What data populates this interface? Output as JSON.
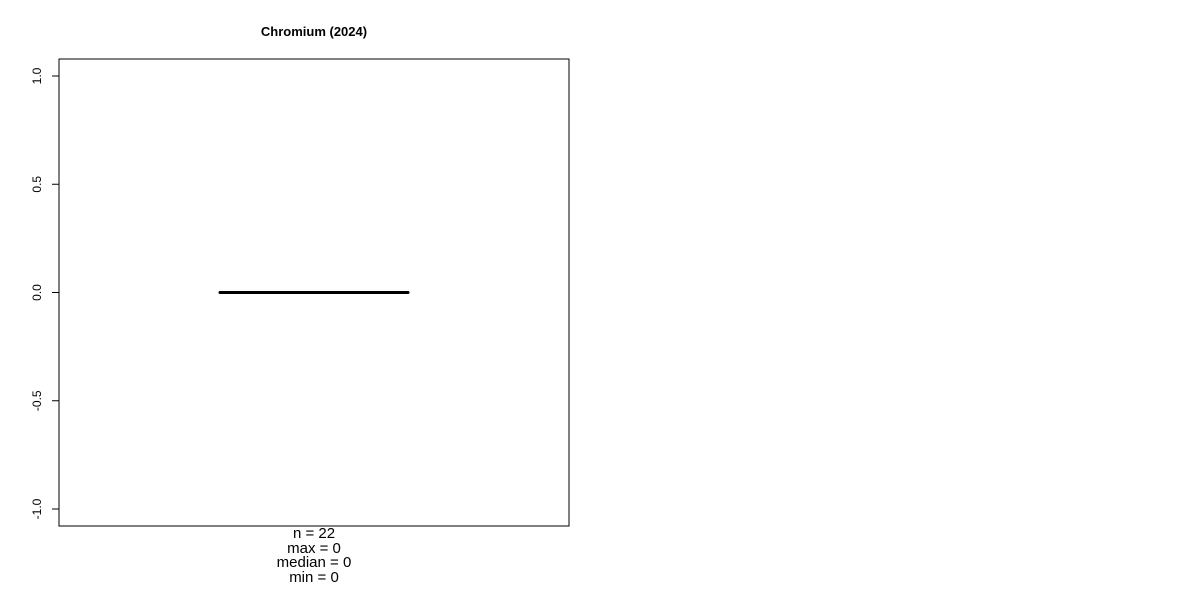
{
  "chart_data": {
    "type": "box",
    "title": "Chromium (2024)",
    "xlabel": "",
    "ylabel": "",
    "ylim": [
      -1.0,
      1.0
    ],
    "y_ticks": [
      -1.0,
      -0.5,
      0.0,
      0.5,
      1.0
    ],
    "y_tick_labels": [
      "-1.0",
      "-0.5",
      "0.0",
      "0.5",
      "1.0"
    ],
    "grid": false,
    "series": [
      {
        "n": 22,
        "min": 0,
        "q1": 0,
        "median": 0,
        "q3": 0,
        "max": 0
      }
    ],
    "summary": {
      "n": "n = 22",
      "max": "max = 0",
      "median": "median = 0",
      "min": "min = 0"
    },
    "colors": {
      "box_line": "#000000",
      "axis": "#000000",
      "background": "#ffffff"
    }
  }
}
